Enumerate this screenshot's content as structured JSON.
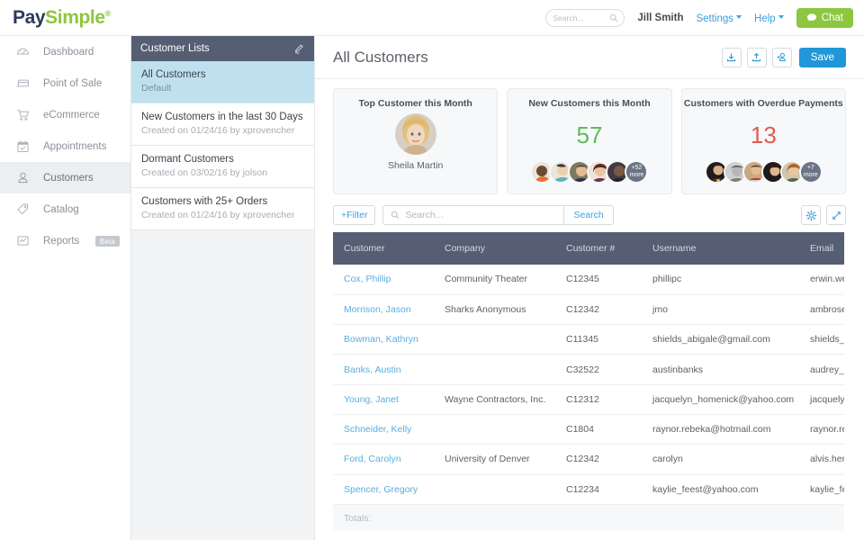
{
  "brand": {
    "part1": "Pay",
    "part2": "Simple",
    "mark": "®"
  },
  "topbar": {
    "search_placeholder": "Search...",
    "user_name": "Jill Smith",
    "settings_label": "Settings",
    "help_label": "Help",
    "chat_label": "Chat",
    "accent_green": "#8dc63f",
    "accent_blue": "#3aa0dd"
  },
  "sidebar": {
    "items": [
      {
        "label": "Dashboard",
        "icon": "gauge-icon",
        "active": false,
        "badge": ""
      },
      {
        "label": "Point of Sale",
        "icon": "card-reader-icon",
        "active": false,
        "badge": ""
      },
      {
        "label": "eCommerce",
        "icon": "shopping-cart-icon",
        "active": false,
        "badge": ""
      },
      {
        "label": "Appointments",
        "icon": "calendar-icon",
        "active": false,
        "badge": ""
      },
      {
        "label": "Customers",
        "icon": "person-icon",
        "active": true,
        "badge": ""
      },
      {
        "label": "Catalog",
        "icon": "tag-icon",
        "active": false,
        "badge": ""
      },
      {
        "label": "Reports",
        "icon": "chart-icon",
        "active": false,
        "badge": "Beta"
      }
    ]
  },
  "list_panel": {
    "header": "Customer Lists",
    "edit_icon": "pencil-icon",
    "items": [
      {
        "name": "All Customers",
        "meta": "Default",
        "selected": true
      },
      {
        "name": "New Customers in the last 30 Days",
        "meta": "Created on 01/24/16 by xprovencher",
        "selected": false
      },
      {
        "name": "Dormant Customers",
        "meta": "Created on 03/02/16 by jolson",
        "selected": false
      },
      {
        "name": "Customers with 25+ Orders",
        "meta": "Created on 01/24/16 by xprovencher",
        "selected": false
      }
    ]
  },
  "main": {
    "title": "All Customers",
    "actions": [
      {
        "name": "download-button",
        "icon": "download-icon"
      },
      {
        "name": "upload-button",
        "icon": "upload-icon"
      },
      {
        "name": "add-customer-button",
        "icon": "add-user-icon"
      }
    ],
    "save_label": "Save"
  },
  "cards": [
    {
      "title": "Top Customer this Month",
      "type": "avatar",
      "customer_name": "Sheila Martin"
    },
    {
      "title": "New Customers this Month",
      "type": "count",
      "value": "57",
      "value_color": "#5cbd5c",
      "overflow_count": "+52",
      "overflow_label": "more",
      "avatar_count": 5
    },
    {
      "title": "Customers with Overdue Payments",
      "type": "count",
      "value": "13",
      "value_color": "#e05b52",
      "overflow_count": "+7",
      "overflow_label": "more",
      "avatar_count": 5
    }
  ],
  "toolbar": {
    "filter_label": "+Filter",
    "search_placeholder": "Search...",
    "search_value": "",
    "search_button": "Search",
    "settings_icon": "gear-icon",
    "expand_icon": "expand-icon"
  },
  "table": {
    "columns": [
      "Customer",
      "Company",
      "Customer #",
      "Username",
      "Email"
    ],
    "rows": [
      {
        "customer": "Cox, Phillip",
        "company": "Community Theater",
        "customer_no": "C12345",
        "username": "phillipc",
        "email": "erwin.weber@yahoo.com"
      },
      {
        "customer": "Morrison, Jason",
        "company": "Sharks Anonymous",
        "customer_no": "C12342",
        "username": "jmo",
        "email": "ambrose.robel@gmail.com"
      },
      {
        "customer": "Bowman, Kathryn",
        "company": "",
        "customer_no": "C11345",
        "username": "shields_abigale@gmail.com",
        "email": "shields_abigale@gmail.com"
      },
      {
        "customer": "Banks, Austin",
        "company": "",
        "customer_no": "C32522",
        "username": "austinbanks",
        "email": "audrey_gottlieb@yahoo.com"
      },
      {
        "customer": "Young, Janet",
        "company": "Wayne Contractors, Inc.",
        "customer_no": "C12312",
        "username": "jacquelyn_homenick@yahoo.com",
        "email": "jacquelyn_homenick@yahoo.com"
      },
      {
        "customer": "Schneider, Kelly",
        "company": "",
        "customer_no": "C1804",
        "username": "raynor.rebeka@hotmail.com",
        "email": "raynor.rebeka@hotmail.com"
      },
      {
        "customer": "Ford, Carolyn",
        "company": "University of Denver",
        "customer_no": "C12342",
        "username": "carolyn",
        "email": "alvis.hermiston@gmail.com"
      },
      {
        "customer": "Spencer, Gregory",
        "company": "",
        "customer_no": "C12234",
        "username": "kaylie_feest@yahoo.com",
        "email": "kaylie_feest@yahoo.com"
      }
    ],
    "totals_label": "Totals:"
  }
}
